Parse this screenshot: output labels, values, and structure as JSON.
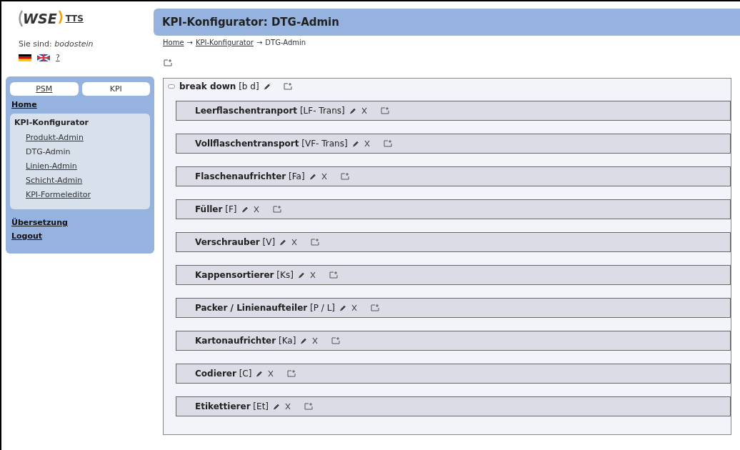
{
  "logo": {
    "brand": "WSE",
    "suffix": "TTS"
  },
  "user": {
    "label": "Sie sind:",
    "name": "bodostein"
  },
  "help": "?",
  "sidebar": {
    "tabs": [
      {
        "label": "PSM",
        "selected": false
      },
      {
        "label": "KPI",
        "selected": true
      }
    ],
    "home": "Home",
    "section": {
      "title": "KPI-Konfigurator",
      "items": [
        {
          "label": "Produkt-Admin",
          "selected": false
        },
        {
          "label": "DTG-Admin",
          "selected": true
        },
        {
          "label": "Linien-Admin",
          "selected": false
        },
        {
          "label": "Schicht-Admin",
          "selected": false
        },
        {
          "label": "KPI-Formeleditor",
          "selected": false
        }
      ]
    },
    "links": [
      "Übersetzung",
      "Logout"
    ]
  },
  "header": {
    "title": "KPI-Konfigurator: DTG-Admin"
  },
  "breadcrumb": [
    {
      "label": "Home",
      "link": true
    },
    {
      "label": "KPI-Konfigurator",
      "link": true
    },
    {
      "label": "DTG-Admin",
      "link": false
    }
  ],
  "breadcrumb_separator": "→",
  "tree": {
    "name": "break down",
    "abbr": "[b d]",
    "expanded": true,
    "children": [
      {
        "name": "Leerflaschentranport",
        "abbr": "[LF- Trans]"
      },
      {
        "name": "Vollflaschentransport",
        "abbr": "[VF- Trans]"
      },
      {
        "name": "Flaschenaufrichter",
        "abbr": "[Fa]"
      },
      {
        "name": "Füller",
        "abbr": "[F]"
      },
      {
        "name": "Verschrauber",
        "abbr": "[V]"
      },
      {
        "name": "Kappensortierer",
        "abbr": "[Ks]"
      },
      {
        "name": "Packer / Linienaufteiler",
        "abbr": "[P / L]"
      },
      {
        "name": "Kartonaufrichter",
        "abbr": "[Ka]"
      },
      {
        "name": "Codierer",
        "abbr": "[C]"
      },
      {
        "name": "Etikettierer",
        "abbr": "[Et]"
      }
    ]
  }
}
